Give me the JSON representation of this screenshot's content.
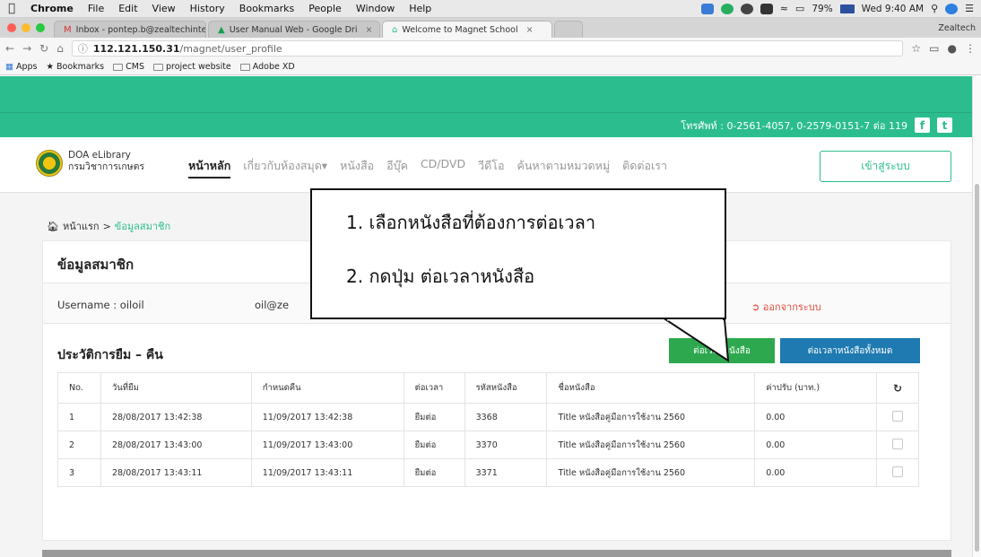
{
  "menubar": {
    "app": "Chrome",
    "items": [
      "File",
      "Edit",
      "View",
      "History",
      "Bookmarks",
      "People",
      "Window",
      "Help"
    ],
    "battery": "79%",
    "clock": "Wed 9:40 AM"
  },
  "tabs": [
    {
      "favicon": "M",
      "label": "Inbox - pontep.b@zealtechinte",
      "close": "×"
    },
    {
      "favicon": "▲",
      "label": "User Manual Web - Google Dri",
      "close": "×"
    },
    {
      "favicon": "⌂",
      "label": "Welcome to Magnet School",
      "close": "×"
    }
  ],
  "profile_name": "Zealtech",
  "address": {
    "host": "112.121.150.31",
    "path": "/magnet/user_profile"
  },
  "bookmarks": [
    {
      "label": "Apps",
      "icon": "apps-icon"
    },
    {
      "label": "Bookmarks",
      "icon": "star-icon"
    },
    {
      "label": "CMS",
      "icon": "folder-icon"
    },
    {
      "label": "project website",
      "icon": "folder-icon"
    },
    {
      "label": "Adobe XD",
      "icon": "folder-icon"
    }
  ],
  "site": {
    "contact": "โทรศัพท์ : 0-2561-4057, 0-2579-0151-7 ต่อ 119",
    "brand_en": "DOA eLibrary",
    "brand_th": "กรมวิชาการเกษตร",
    "nav": [
      "หน้าหลัก",
      "เกี่ยวกับห้องสมุด▾",
      "หนังสือ",
      "อีบุ๊ค",
      "CD/DVD",
      "วีดีโอ",
      "ค้นหาตามหมวดหมู่",
      "ติดต่อเรา"
    ],
    "login": "เข้าสู่ระบบ"
  },
  "breadcrumb": {
    "home": "หน้าแรก",
    "sep": ">",
    "current": "ข้อมูลสมาชิก"
  },
  "profile": {
    "title": "ข้อมูลสมาชิก",
    "username": "Username : oiloil",
    "email": "oil@ze",
    "logout": "ออกจากระบบ"
  },
  "history": {
    "title": "ประวัติการยืม – คืน",
    "renew_button": "ต่อเวลาหนังสือ",
    "renew_all_button": "ต่อเวลาหนังสือทั้งหมด",
    "columns": [
      "No.",
      "วันที่ยืม",
      "กำหนดคืน",
      "ต่อเวลา",
      "รหัสหนังสือ",
      "ชื่อหนังสือ",
      "ค่าปรับ (บาท.)"
    ],
    "rows": [
      {
        "no": "1",
        "borrowed": "28/08/2017 13:42:38",
        "due": "11/09/2017 13:42:38",
        "renew": "ยืมต่อ",
        "code": "3368",
        "name": "Title หนังสือคู่มือการใช้งาน 2560",
        "fine": "0.00"
      },
      {
        "no": "2",
        "borrowed": "28/08/2017 13:43:00",
        "due": "11/09/2017 13:43:00",
        "renew": "ยืมต่อ",
        "code": "3370",
        "name": "Title หนังสือคู่มือการใช้งาน 2560",
        "fine": "0.00"
      },
      {
        "no": "3",
        "borrowed": "28/08/2017 13:43:11",
        "due": "11/09/2017 13:43:11",
        "renew": "ยืมต่อ",
        "code": "3371",
        "name": "Title หนังสือคู่มือการใช้งาน 2560",
        "fine": "0.00"
      }
    ]
  },
  "callout": {
    "step1": "1.   เลือกหนังสือที่ต้องการต่อเวลา",
    "step2": "2.   กดปุ่ม ต่อเวลาหนังสือ"
  },
  "colors": {
    "brand_green": "#2bbd8e",
    "renew_green": "#2ea84f",
    "renew_all_blue": "#1e7ab0",
    "logout_red": "#e74c3c"
  }
}
